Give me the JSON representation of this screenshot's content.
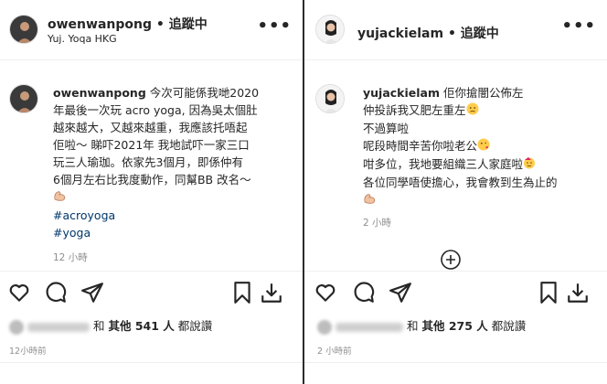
{
  "left": {
    "username": "owenwanpong",
    "follow_label": "• 追蹤中",
    "location": "Yuj. Yoqa HKG",
    "caption_lines": [
      "今次可能係我哋2020",
      "年最後一次玩 acro yoga, 因為吳太個肚",
      "越來越大，又越來越重，我應該托唔起",
      "佢啦～ 睇吓2021年 我地試吓一家三口",
      "玩三人瑜珈。依家先3個月，即係仲有",
      "6個月左右比我度動作，同幫BB 改名～"
    ],
    "hashtags": [
      "#acroyoga",
      "#yoga"
    ],
    "post_time": "12 小時",
    "liked_by": "yujackielam",
    "likes_text": "和",
    "others_label": "其他 541 人",
    "liked_suffix": "都說讚",
    "footer_time": "12小時前"
  },
  "right": {
    "username": "yujackielam",
    "follow_label": "• 追蹤中",
    "caption_lines": [
      "佢你搶闇公佈左",
      "仲投訴我又肥左重左",
      "不過算啦",
      "呢段時間辛苦你啦老公",
      "咁多位，我地要組織三人家庭啦",
      "各位同學唔使擔心，我會教到生為止的"
    ],
    "post_time": "2 小時",
    "liked_by": "coffee89921",
    "likes_text": "和",
    "others_label": "其他 275 人",
    "liked_suffix": "都說讚",
    "footer_time": "2 小時前"
  },
  "icons": [
    "more-icon",
    "heart-icon",
    "comment-icon",
    "share-icon",
    "bookmark-icon",
    "download-icon",
    "add-comment-icon",
    "flex-emoji",
    "worried-emoji",
    "kiss-emoji",
    "party-emoji"
  ]
}
